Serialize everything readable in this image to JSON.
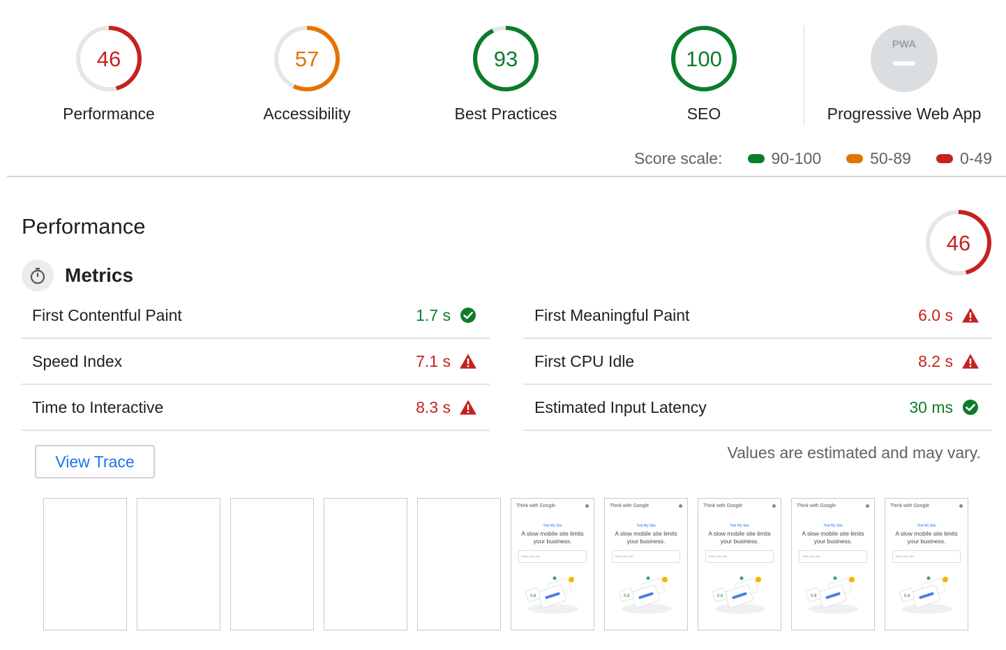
{
  "colors": {
    "pass": "#0c7d2a",
    "average": "#e37400",
    "fail": "#c5221f",
    "track": "#e6e6e6",
    "link": "#1a73e8",
    "pwa_gray": "#cfd3d6"
  },
  "summary": {
    "gauges": [
      {
        "score": "46",
        "label": "Performance",
        "fraction": 0.46,
        "status": "fail"
      },
      {
        "score": "57",
        "label": "Accessibility",
        "fraction": 0.57,
        "status": "average"
      },
      {
        "score": "93",
        "label": "Best Practices",
        "fraction": 0.93,
        "status": "pass"
      },
      {
        "score": "100",
        "label": "SEO",
        "fraction": 1.0,
        "status": "pass"
      }
    ],
    "pwa": {
      "badge_text": "PWA",
      "label": "Progressive Web App",
      "icon": "pwa-badge-icon"
    }
  },
  "score_scale": {
    "title": "Score scale:",
    "items": [
      {
        "range": "90-100",
        "status": "pass"
      },
      {
        "range": "50-89",
        "status": "average"
      },
      {
        "range": "0-49",
        "status": "fail"
      }
    ]
  },
  "performance": {
    "title": "Performance",
    "score": "46",
    "fraction": 0.46,
    "metrics_title": "Metrics",
    "metrics_icon": "stopwatch-icon",
    "metrics_left": [
      {
        "name": "First Contentful Paint",
        "value": "1.7 s",
        "status": "pass",
        "icon": "check-circle-icon"
      },
      {
        "name": "Speed Index",
        "value": "7.1 s",
        "status": "fail",
        "icon": "warning-triangle-icon"
      },
      {
        "name": "Time to Interactive",
        "value": "8.3 s",
        "status": "fail",
        "icon": "warning-triangle-icon"
      }
    ],
    "metrics_right": [
      {
        "name": "First Meaningful Paint",
        "value": "6.0 s",
        "status": "fail",
        "icon": "warning-triangle-icon"
      },
      {
        "name": "First CPU Idle",
        "value": "8.2 s",
        "status": "fail",
        "icon": "warning-triangle-icon"
      },
      {
        "name": "Estimated Input Latency",
        "value": "30 ms",
        "status": "pass",
        "icon": "check-circle-icon"
      }
    ],
    "view_trace_label": "View Trace",
    "estimate_note": "Values are estimated and may vary."
  },
  "filmstrip": {
    "frames": [
      {
        "loaded": false
      },
      {
        "loaded": false
      },
      {
        "loaded": false
      },
      {
        "loaded": false
      },
      {
        "loaded": false
      },
      {
        "loaded": true
      },
      {
        "loaded": true
      },
      {
        "loaded": true
      },
      {
        "loaded": true
      },
      {
        "loaded": true
      }
    ],
    "screenshot": {
      "brand": "Think with Google",
      "kicker": "Test My Site",
      "headline": "A slow mobile site limits your business.",
      "input_placeholder": "Enter your site",
      "badge": "0.8"
    }
  }
}
